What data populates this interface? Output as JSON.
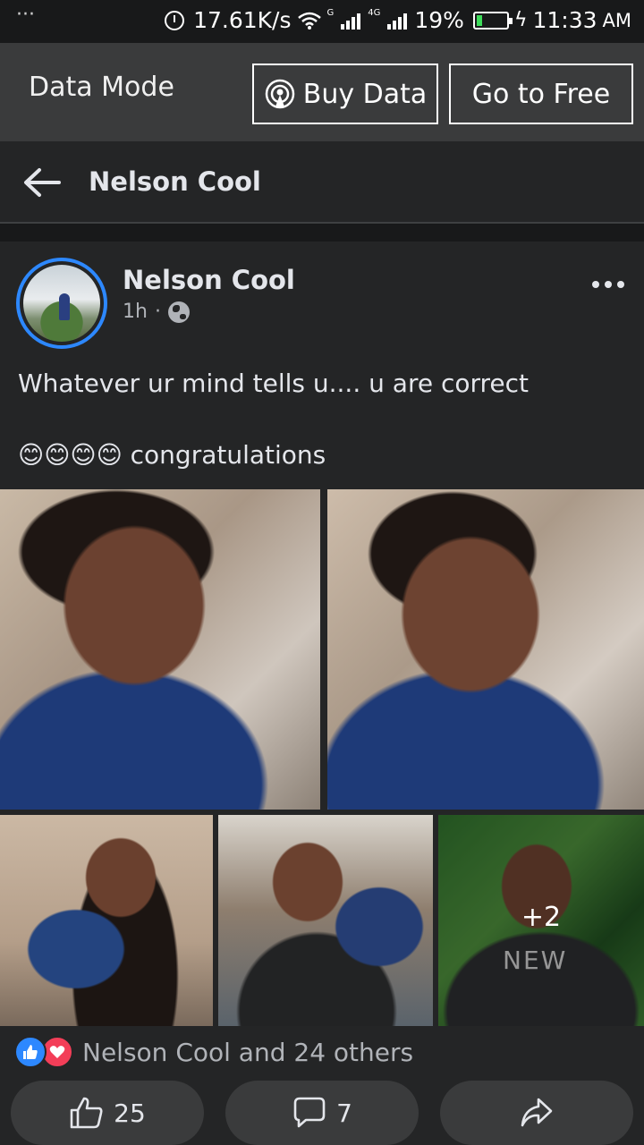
{
  "status_bar": {
    "menu": "···",
    "speed": "17.61K/s",
    "signal1_tag": "G",
    "signal2_tag": "4G",
    "battery": "19%",
    "battery_level": 0.19,
    "time": "11:33",
    "ampm": "AM"
  },
  "data_bar": {
    "label": "Data Mode",
    "buy_label": "Buy Data",
    "free_label": "Go to Free"
  },
  "header": {
    "title": "Nelson Cool"
  },
  "post": {
    "author": "Nelson Cool",
    "time": "1h",
    "separator": "·",
    "text_line1": "Whatever ur mind tells u.... u are correct",
    "text_line2": "😊😊😊😊 congratulations",
    "more_photos": "+2",
    "shirt_text": "NEW",
    "reactions_text": "Nelson Cool and 24 others",
    "like_count": "25",
    "comment_count": "7"
  },
  "colors": {
    "accent": "#2d88ff",
    "love": "#f33e58",
    "background": "#242526"
  }
}
